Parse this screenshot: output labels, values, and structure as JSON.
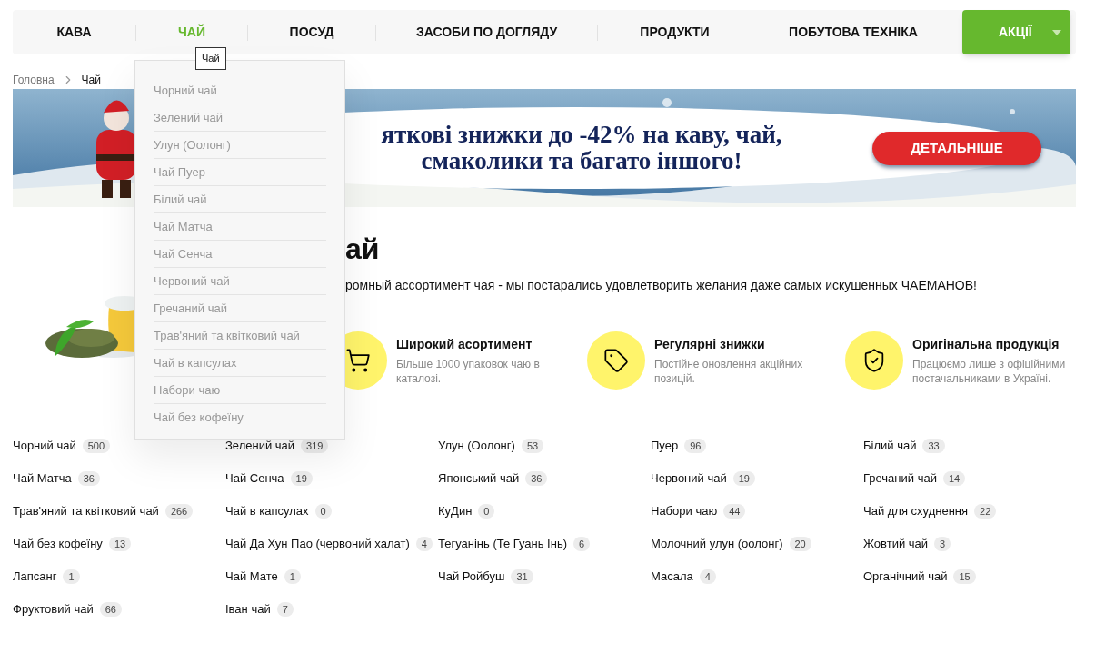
{
  "nav": {
    "items": [
      {
        "label": "КАВА",
        "selected": false
      },
      {
        "label": "ЧАЙ",
        "selected": true
      },
      {
        "label": "ПОСУД",
        "selected": false
      },
      {
        "label": "ЗАСОБИ ПО ДОГЛЯДУ",
        "selected": false
      },
      {
        "label": "ПРОДУКТИ",
        "selected": false
      },
      {
        "label": "ПОБУТОВА ТЕХНІКА",
        "selected": false
      }
    ],
    "promo_button": "АКЦІЇ"
  },
  "tooltip": "Чай",
  "dropdown": {
    "items": [
      "Чорний чай",
      "Зелений чай",
      "Улун (Оолонг)",
      "Чай Пуер",
      "Білий чай",
      "Чай Матча",
      "Чай Сенча",
      "Червоний чай",
      "Гречаний чай",
      "Трав'яний та квітковий чай",
      "Чай в капсулах",
      "Набори чаю",
      "Чай без кофеїну"
    ]
  },
  "breadcrumb": [
    "Головна",
    "Чай"
  ],
  "banner": {
    "headline_lines": [
      "яткові знижки до -42% на каву, чай,",
      "смаколики та багато іншого!"
    ],
    "button": "ДЕТАЛЬНІШЕ"
  },
  "heading": "ай",
  "description": "ромный ассортимент чая - мы постарались удовлетворить желания даже самых искушенных ЧАЕМАНОВ!",
  "features": [
    {
      "kind": "cart",
      "title": "Широкий асортимент",
      "text": "Більше 1000 упаковок чаю в каталозі."
    },
    {
      "kind": "tag",
      "title": "Регулярні знижки",
      "text": "Постійне оновлення акційних позицій."
    },
    {
      "kind": "shield",
      "title": "Оригінальна продукція",
      "text": "Працюємо лише з офіційними постачальниками в Україні."
    }
  ],
  "categories": [
    {
      "name": "Чорний чай",
      "count": "500"
    },
    {
      "name": "Зелений чай",
      "count": "319"
    },
    {
      "name": "Улун (Оолонг)",
      "count": "53"
    },
    {
      "name": "Пуер",
      "count": "96"
    },
    {
      "name": "Білий чай",
      "count": "33"
    },
    {
      "name": "Чай Матча",
      "count": "36"
    },
    {
      "name": "Чай Сенча",
      "count": "19"
    },
    {
      "name": "Японський чай",
      "count": "36"
    },
    {
      "name": "Червоний чай",
      "count": "19"
    },
    {
      "name": "Гречаний чай",
      "count": "14"
    },
    {
      "name": "Трав'яний та квітковий чай",
      "count": "266"
    },
    {
      "name": "Чай в капсулах",
      "count": "0"
    },
    {
      "name": "КуДин",
      "count": "0"
    },
    {
      "name": "Набори чаю",
      "count": "44"
    },
    {
      "name": "Чай для схуднення",
      "count": "22"
    },
    {
      "name": "Чай без кофеїну",
      "count": "13"
    },
    {
      "name": "Чай Да Хун Пао (червоний халат)",
      "count": "4"
    },
    {
      "name": "Тегуанінь (Те Гуань Інь)",
      "count": "6"
    },
    {
      "name": "Молочний улун (оолонг)",
      "count": "20"
    },
    {
      "name": "Жовтий чай",
      "count": "3"
    },
    {
      "name": "Лапсанг",
      "count": "1"
    },
    {
      "name": "Чай Мате",
      "count": "1"
    },
    {
      "name": "Чай Ройбуш",
      "count": "31"
    },
    {
      "name": "Масала",
      "count": "4"
    },
    {
      "name": "Органічний чай",
      "count": "15"
    },
    {
      "name": "Фруктовий чай",
      "count": "66"
    },
    {
      "name": "Іван чай",
      "count": "7"
    }
  ]
}
